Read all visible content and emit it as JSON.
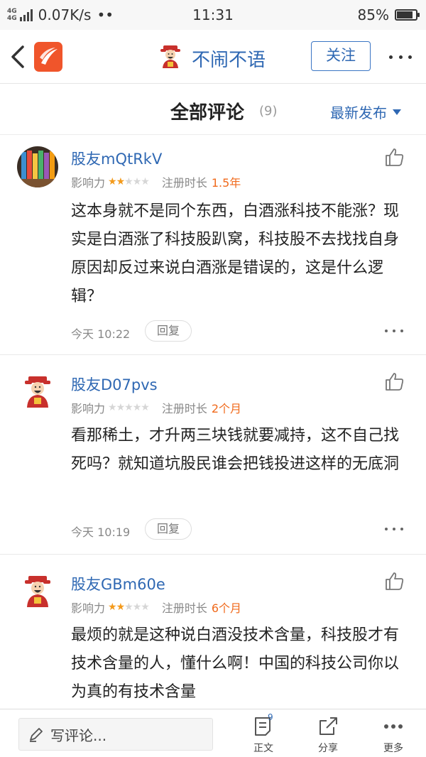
{
  "status_bar": {
    "network_1": "4G",
    "network_2": "4G",
    "speed": "0.07K/s",
    "more_indicator": "••",
    "time": "11:31",
    "battery_text": "85%",
    "battery_level": 0.85
  },
  "nav": {
    "title": "不闹不语",
    "follow_label": "关注"
  },
  "header": {
    "title": "全部评论",
    "count": "(9)",
    "sort_label": "最新发布"
  },
  "meta_labels": {
    "influence": "影响力",
    "registered": "注册时长",
    "reply": "回复"
  },
  "comments": [
    {
      "user": "股友mQtRkV",
      "influence_stars": 1.5,
      "registered": "1.5年",
      "text": "这本身就不是同个东西，白酒涨科技不能涨？现实是白酒涨了科技股趴窝，科技股不去找找自身原因却反过来说白酒涨是错误的，这是什么逻辑？",
      "time": "今天 10:22",
      "avatar": "pencils"
    },
    {
      "user": "股友D07pvs",
      "influence_stars": 0,
      "registered": "2个月",
      "text": "看那稀土，才升两三块钱就要减持，这不自己找死吗？就知道坑股民谁会把钱投进这样的无底洞",
      "time": "今天 10:19",
      "avatar": "fortune-god"
    },
    {
      "user": "股友GBm60e",
      "influence_stars": 1.5,
      "registered": "6个月",
      "text": "最烦的就是这种说白酒没技术含量，科技股才有技术含量的人，懂什么啊！中国的科技公司你以为真的有技术含量",
      "time": "",
      "avatar": "fortune-god"
    }
  ],
  "bottom_bar": {
    "write_placeholder": "写评论...",
    "article_label": "正文",
    "article_badge": "9",
    "share_label": "分享",
    "more_label": "更多"
  },
  "colors": {
    "link_blue": "#2f68b3",
    "star_orange": "#f39a1c",
    "value_orange": "#f06a1c",
    "logo_red": "#f0552b"
  }
}
